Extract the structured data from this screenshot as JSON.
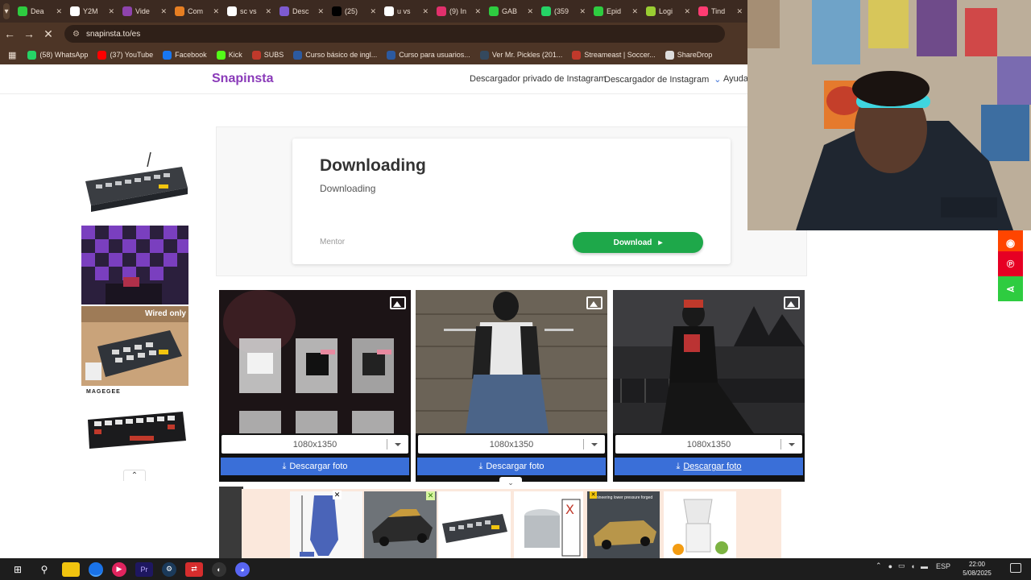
{
  "browser": {
    "tabs": [
      {
        "label": "Dea",
        "color": "#2ecc40"
      },
      {
        "label": "Y2M",
        "color": "#ffffff"
      },
      {
        "label": "Vide",
        "color": "#8e44ad"
      },
      {
        "label": "Com",
        "color": "#e67e22"
      },
      {
        "label": "sc vs",
        "color": "#ffffff"
      },
      {
        "label": "Desc",
        "color": "#7d5ad0"
      },
      {
        "label": "(25)",
        "color": "#000000"
      },
      {
        "label": "u vs",
        "color": "#ffffff"
      },
      {
        "label": "(9) In",
        "color": "#e1306c"
      },
      {
        "label": "GAB",
        "color": "#2ecc40"
      },
      {
        "label": "(359",
        "color": "#25d366"
      },
      {
        "label": "Epid",
        "color": "#2ecc40"
      },
      {
        "label": "Logi",
        "color": "#9acd32"
      },
      {
        "label": "Tind",
        "color": "#fe3c72"
      }
    ],
    "url": "snapinsta.to/es",
    "bookmarks": [
      {
        "label": "(58) WhatsApp",
        "color": "#25d366"
      },
      {
        "label": "(37) YouTube",
        "color": "#ff0000"
      },
      {
        "label": "Facebook",
        "color": "#1877f2"
      },
      {
        "label": "Kick",
        "color": "#53fc18"
      },
      {
        "label": "SUBS",
        "color": "#c0392b"
      },
      {
        "label": "Curso básico de ingl...",
        "color": "#2c5aa0"
      },
      {
        "label": "Curso para usuarios...",
        "color": "#2c5aa0"
      },
      {
        "label": "Ver Mr. Pickles (201...",
        "color": "#34495e"
      },
      {
        "label": "Streameast | Soccer...",
        "color": "#c0392b"
      },
      {
        "label": "ShareDrop",
        "color": "#dddddd"
      }
    ]
  },
  "site": {
    "logo": "Snapinsta",
    "nav": {
      "private": "Descargador privado de Instagram",
      "downloader": "Descargador de Instagram",
      "help": "Ayuda"
    }
  },
  "download_card": {
    "title": "Downloading",
    "subtitle": "Downloading",
    "mentor": "Mentor",
    "button": "Download"
  },
  "ads_left": {
    "label1": "Wired only",
    "brand": "MAGEGEE"
  },
  "results": [
    {
      "resolution": "1080x1350",
      "button": "Descargar foto"
    },
    {
      "resolution": "1080x1350",
      "button": "Descargar foto"
    },
    {
      "resolution": "1080x1350",
      "button": "Descargar foto"
    }
  ],
  "bottom_ads": {
    "ad_text": "Domineering lower pressure forged"
  },
  "taskbar": {
    "lang": "ESP",
    "time": "22:00",
    "date": "5/08/2025"
  }
}
